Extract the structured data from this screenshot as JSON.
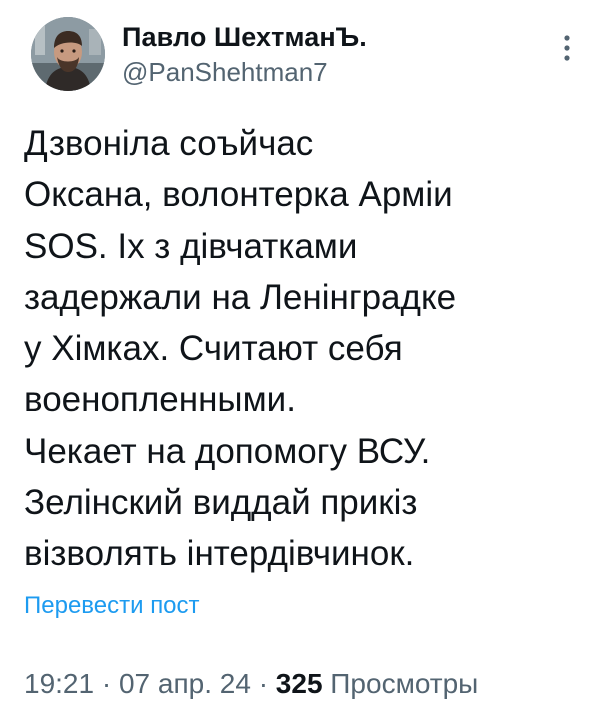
{
  "tweet": {
    "author": {
      "display_name": "Павло ШехтманЪ.",
      "handle": "@PanShehtman7",
      "avatar_icon": "avatar-photo"
    },
    "menu_icon": "more-vertical-icon",
    "text_lines": [
      "Дзвоніла соъйчас",
      "Оксана, волонтерка Арміи",
      "SOS. Іх з дівчатками",
      "задержали  на Ленінградке",
      "у Хімках. Считают себя",
      "военопленными.",
      "Чекает на допомогу ВСУ.",
      "Зелінский виддай прикіз",
      "візволять інтердівчинок."
    ],
    "translate_label": "Перевести пост",
    "time": "19:21",
    "separator": "·",
    "date": "07 апр. 24",
    "views_count": "325",
    "views_label": "Просмотры"
  },
  "colors": {
    "text_primary": "#0f1419",
    "text_secondary": "#536471",
    "link": "#1d9bf0",
    "background": "#ffffff"
  }
}
